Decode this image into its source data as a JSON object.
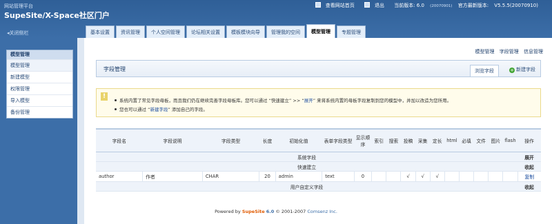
{
  "header": {
    "platform": "网站管理平台",
    "brand": "SupeSite/X-Space社区门户",
    "view_site": "查看网站首页",
    "logout": "退出",
    "current_version_label": "当前版本: 6.0",
    "current_version_build": "(20070901)",
    "latest_version_label": "官方最新版本:",
    "latest_version": "V5.5.5(20070910)",
    "collapse": "关闭侧栏"
  },
  "tabs": [
    "基本设置",
    "资讯管理",
    "个人空间管理",
    "论坛相关设置",
    "模板模块向导",
    "管理我的空间",
    "模型管理",
    "专题管理"
  ],
  "active_tab": 6,
  "sidebar": {
    "title": "模型管理",
    "items": [
      "模型管理",
      "新建模型",
      "权限管理",
      "导入模型",
      "备份管理"
    ]
  },
  "sublinks": [
    "模型管理",
    "字段管理",
    "信息管理"
  ],
  "section": {
    "title": "字段管理",
    "browse_button": "浏览字段",
    "new_button": "新建字段"
  },
  "tip": {
    "line1_before": "系统内置了常见字段母板，而且我们仍在继续完善字段母板库。您可以通过 “快速建立” >> “",
    "line1_link": "展开",
    "line1_after": "” 来将系统内置的母板字段复制到您的模型中，并加以改造为您所用。",
    "line2_before": "您也可以通过 “",
    "line2_link": "新建字段",
    "line2_after": "” 添加自己的字段。"
  },
  "table": {
    "headers": [
      "字段名",
      "字段说明",
      "字段类型",
      "长度",
      "初始化值",
      "表单字段类型",
      "显示顺序",
      "索引",
      "搜索",
      "投稿",
      "采集",
      "定长",
      "html",
      "必填",
      "文件",
      "图片",
      "flash",
      "操作"
    ],
    "sections": {
      "system": {
        "label": "系统字段",
        "action": "展开"
      },
      "quick": {
        "label": "快速建立",
        "action": "收起"
      },
      "custom": {
        "label": "用户自定义字段",
        "action": "收起"
      }
    },
    "row": {
      "name": "author",
      "desc": "作者",
      "type": "CHAR",
      "length": "20",
      "init": "admin",
      "form_type": "text",
      "order": "0",
      "index": "",
      "search": "",
      "contribute": "√",
      "collect": "√",
      "fixed": "√",
      "html": "",
      "required": "",
      "file": "",
      "image": "",
      "flash": "",
      "action": "复制"
    }
  },
  "footer": {
    "powered": "Powered by",
    "brand": "SupeSite",
    "version": "6.0",
    "copyright": "© 2001-2007",
    "company": "Comsenz Inc."
  }
}
